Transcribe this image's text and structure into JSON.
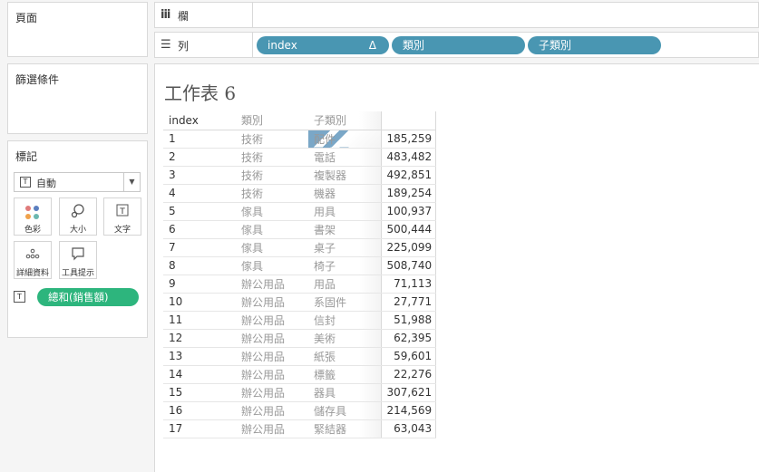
{
  "panels": {
    "pages_title": "頁面",
    "filters_title": "篩選條件",
    "marks_title": "標記"
  },
  "marks": {
    "type_label": "自動",
    "type_icon": "text-mark-icon",
    "buttons": [
      {
        "label": "色彩",
        "icon": "color-dots-icon"
      },
      {
        "label": "大小",
        "icon": "size-icon"
      },
      {
        "label": "文字",
        "icon": "text-icon"
      },
      {
        "label": "詳細資料",
        "icon": "detail-icon"
      },
      {
        "label": "工具提示",
        "icon": "tooltip-icon"
      }
    ],
    "field_pill": "總和(銷售額)",
    "field_pill_icon": "text-mark-icon"
  },
  "shelves": {
    "columns_label": "欄",
    "rows_label": "列",
    "row_pills": [
      {
        "label": "index",
        "marker": "Δ"
      },
      {
        "label": "類別"
      },
      {
        "label": "子類別"
      }
    ]
  },
  "sheet": {
    "title": "工作表 6",
    "headers": [
      "index",
      "類別",
      "子類別",
      ""
    ],
    "rows": [
      {
        "index": "1",
        "category": "技術",
        "subcategory": "配件",
        "value": "185,259"
      },
      {
        "index": "2",
        "category": "技術",
        "subcategory": "電話",
        "value": "483,482"
      },
      {
        "index": "3",
        "category": "技術",
        "subcategory": "複製器",
        "value": "492,851"
      },
      {
        "index": "4",
        "category": "技術",
        "subcategory": "機器",
        "value": "189,254"
      },
      {
        "index": "5",
        "category": "傢具",
        "subcategory": "用具",
        "value": "100,937"
      },
      {
        "index": "6",
        "category": "傢具",
        "subcategory": "書架",
        "value": "500,444"
      },
      {
        "index": "7",
        "category": "傢具",
        "subcategory": "桌子",
        "value": "225,099"
      },
      {
        "index": "8",
        "category": "傢具",
        "subcategory": "椅子",
        "value": "508,740"
      },
      {
        "index": "9",
        "category": "辦公用品",
        "subcategory": "用品",
        "value": "71,113"
      },
      {
        "index": "10",
        "category": "辦公用品",
        "subcategory": "系固件",
        "value": "27,771"
      },
      {
        "index": "11",
        "category": "辦公用品",
        "subcategory": "信封",
        "value": "51,988"
      },
      {
        "index": "12",
        "category": "辦公用品",
        "subcategory": "美術",
        "value": "62,395"
      },
      {
        "index": "13",
        "category": "辦公用品",
        "subcategory": "紙張",
        "value": "59,601"
      },
      {
        "index": "14",
        "category": "辦公用品",
        "subcategory": "標籤",
        "value": "22,276"
      },
      {
        "index": "15",
        "category": "辦公用品",
        "subcategory": "器具",
        "value": "307,621"
      },
      {
        "index": "16",
        "category": "辦公用品",
        "subcategory": "儲存具",
        "value": "214,569"
      },
      {
        "index": "17",
        "category": "辦公用品",
        "subcategory": "緊結器",
        "value": "63,043"
      }
    ]
  },
  "colors": {
    "blue_pill": "#4996b2",
    "green_pill": "#2db57d",
    "dot_red": "#e07b7b",
    "dot_blue": "#5b7fbf",
    "dot_orange": "#f0a24b",
    "dot_teal": "#6bb8b0"
  }
}
